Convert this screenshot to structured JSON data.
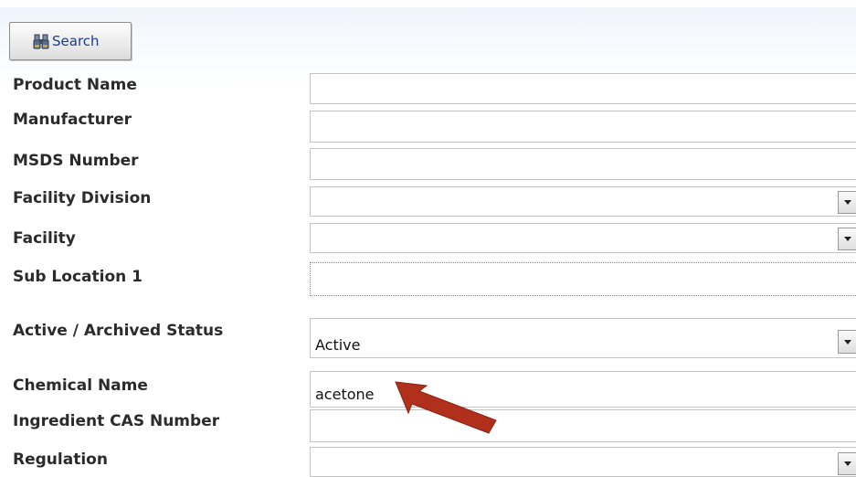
{
  "toolbar": {
    "search_label": "Search",
    "search_icon": "binoculars-icon"
  },
  "form": {
    "fields": [
      {
        "label": "Product Name",
        "type": "text",
        "value": ""
      },
      {
        "label": "Manufacturer",
        "type": "text",
        "value": ""
      },
      {
        "label": "MSDS Number",
        "type": "text",
        "value": ""
      },
      {
        "label": "Facility Division",
        "type": "select",
        "value": ""
      },
      {
        "label": "Facility",
        "type": "select",
        "value": ""
      },
      {
        "label": "Sub Location 1",
        "type": "text",
        "value": ""
      },
      {
        "label": "Active / Archived Status",
        "type": "select",
        "value": "Active"
      },
      {
        "label": "Chemical Name",
        "type": "text",
        "value": "acetone"
      },
      {
        "label": "Ingredient CAS Number",
        "type": "text",
        "value": ""
      },
      {
        "label": "Regulation",
        "type": "select",
        "value": ""
      }
    ]
  },
  "annotation": {
    "arrow_icon": "red-arrow-icon",
    "arrow_color": "#b0301c"
  }
}
